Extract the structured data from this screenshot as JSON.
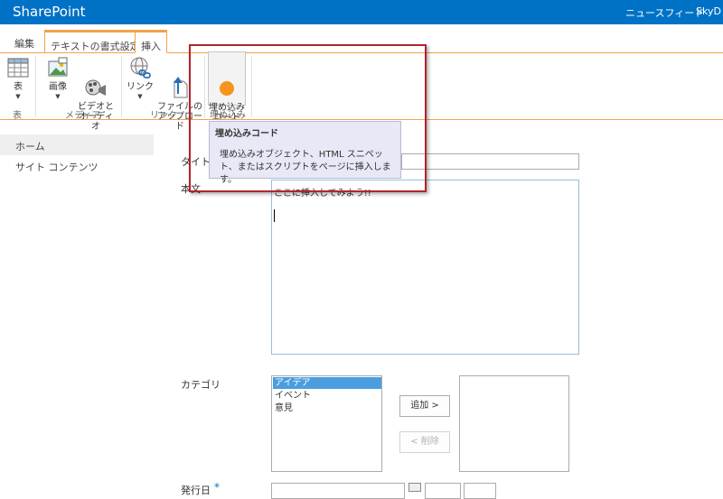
{
  "suite": {
    "brand": "SharePoint",
    "newsfeed": "ニュースフィード",
    "skydrive": "SkyD"
  },
  "tabs": [
    {
      "label": "編集"
    },
    {
      "label": "テキストの書式設定"
    },
    {
      "label": "挿入"
    }
  ],
  "ribbon": {
    "groups": [
      {
        "label": "表",
        "buttons": [
          {
            "label": "表",
            "icon": "table-icon"
          }
        ]
      },
      {
        "label": "メディア",
        "buttons": [
          {
            "label": "画像",
            "icon": "image-icon"
          },
          {
            "label": "ビデオと\nオーディオ",
            "icon": "video-audio-icon"
          }
        ]
      },
      {
        "label": "リンク",
        "buttons": [
          {
            "label": "リンク",
            "icon": "link-icon"
          },
          {
            "label": "ファイルの\nアップロード",
            "icon": "upload-icon"
          }
        ]
      },
      {
        "label": "埋め込み",
        "buttons": [
          {
            "label": "埋め込み\nコード",
            "icon": "embed-code-icon"
          }
        ]
      }
    ]
  },
  "tooltip": {
    "title": "埋め込みコード",
    "description": "埋め込みオブジェクト、HTML スニペット、またはスクリプトをページに挿入します。"
  },
  "nav": {
    "home": "ホーム",
    "contents": "サイト コンテンツ"
  },
  "form": {
    "title_label": "タイトル",
    "body_label": "本文",
    "body_text": "ここに挿入してみよう!!",
    "category_label": "カテゴリ",
    "category_options": [
      "アイデア",
      "イベント",
      "意見"
    ],
    "selected_option": "アイデア",
    "add_button": "追加 >",
    "remove_button": "< 削除",
    "date_label": "発行日",
    "date_required": "*"
  },
  "colors": {
    "suite_bar": "#0072c6",
    "tab_accent": "#f2a24b",
    "highlight": "#b3242c",
    "tooltip_bg": "#e8e8f6",
    "selection": "#4a9ee0"
  }
}
